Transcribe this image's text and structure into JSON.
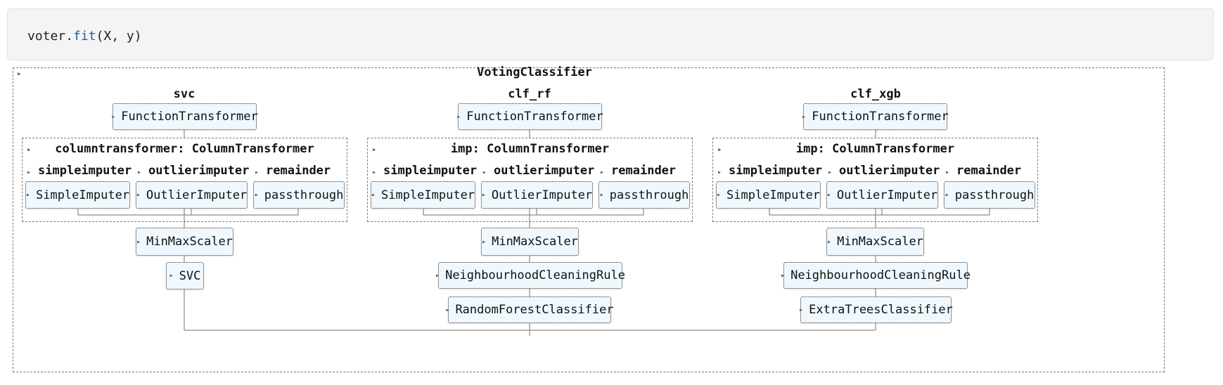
{
  "code": {
    "object": "voter",
    "dot": ".",
    "method": "fit",
    "args": "(X, y)"
  },
  "root": {
    "label": "VotingClassifier"
  },
  "branches": [
    {
      "name": "svc",
      "transformer": "FunctionTransformer",
      "group_label": "columntransformer: ColumnTransformer",
      "columns": [
        {
          "name": "simpleimputer",
          "estimator": "SimpleImputer"
        },
        {
          "name": "outlierimputer",
          "estimator": "OutlierImputer"
        },
        {
          "name": "remainder",
          "estimator": "passthrough"
        }
      ],
      "steps": [
        "MinMaxScaler",
        "SVC"
      ]
    },
    {
      "name": "clf_rf",
      "transformer": "FunctionTransformer",
      "group_label": "imp: ColumnTransformer",
      "columns": [
        {
          "name": "simpleimputer",
          "estimator": "SimpleImputer"
        },
        {
          "name": "outlierimputer",
          "estimator": "OutlierImputer"
        },
        {
          "name": "remainder",
          "estimator": "passthrough"
        }
      ],
      "steps": [
        "MinMaxScaler",
        "NeighbourhoodCleaningRule",
        "RandomForestClassifier"
      ]
    },
    {
      "name": "clf_xgb",
      "transformer": "FunctionTransformer",
      "group_label": "imp: ColumnTransformer",
      "columns": [
        {
          "name": "simpleimputer",
          "estimator": "SimpleImputer"
        },
        {
          "name": "outlierimputer",
          "estimator": "OutlierImputer"
        },
        {
          "name": "remainder",
          "estimator": "passthrough"
        }
      ],
      "steps": [
        "MinMaxScaler",
        "NeighbourhoodCleaningRule",
        "ExtraTreesClassifier"
      ]
    }
  ]
}
